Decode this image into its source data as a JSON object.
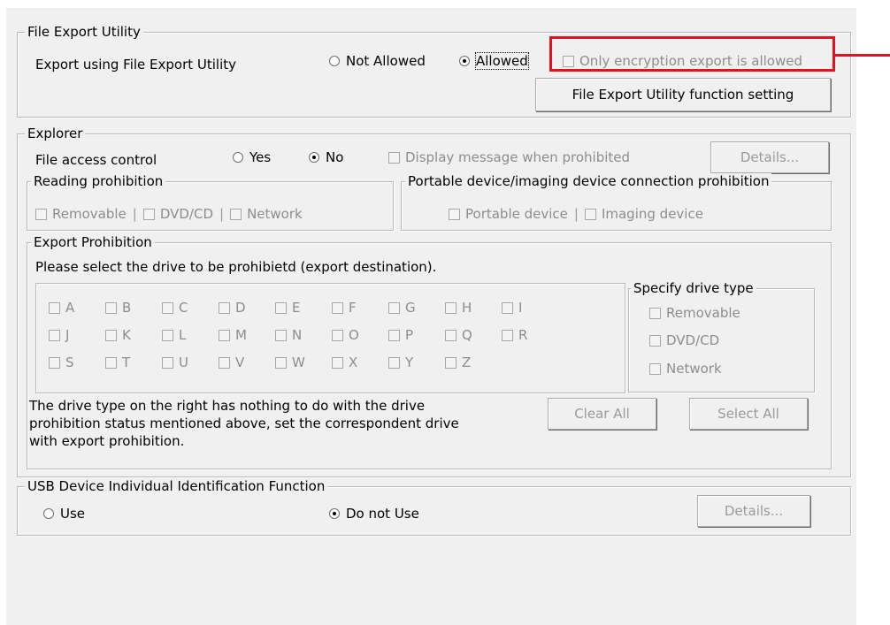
{
  "file_export": {
    "title": "File Export Utility",
    "export_label": "Export using File Export Utility",
    "not_allowed": "Not Allowed",
    "allowed": "Allowed",
    "selected": "allowed",
    "only_encryption": "Only encryption export is allowed",
    "function_setting_button": "File Export Utility function setting",
    "highlight_color": "#e3121c"
  },
  "explorer": {
    "title": "Explorer",
    "file_access_label": "File access control",
    "yes": "Yes",
    "no": "No",
    "selected": "no",
    "display_message": "Display message when prohibited",
    "details_button": "Details...",
    "reading": {
      "title": "Reading prohibition",
      "removable": "Removable",
      "dvd": "DVD/CD",
      "network": "Network"
    },
    "portable": {
      "title": "Portable device/imaging device connection prohibition",
      "portable_device": "Portable device",
      "imaging_device": "Imaging device"
    },
    "export_prohibition": {
      "title": "Export Prohibition",
      "instruction": "Please select the drive to be prohibietd (export destination).",
      "drive_rows": [
        [
          "A",
          "B",
          "C",
          "D",
          "E",
          "F",
          "G",
          "H",
          "I"
        ],
        [
          "J",
          "K",
          "L",
          "M",
          "N",
          "O",
          "P",
          "Q",
          "R"
        ],
        [
          "S",
          "T",
          "U",
          "V",
          "W",
          "X",
          "Y",
          "Z"
        ]
      ],
      "specify": {
        "title": "Specify drive type",
        "removable": "Removable",
        "dvd": "DVD/CD",
        "network": "Network"
      },
      "note_1": "The drive type on the right has nothing to do with the drive",
      "note_2": "prohibition status mentioned above, set the correspondent drive",
      "note_3": "with export prohibition.",
      "clear_all": "Clear All",
      "select_all": "Select All"
    }
  },
  "usb": {
    "title": "USB Device Individual Identification Function",
    "use": "Use",
    "do_not_use": "Do not Use",
    "selected": "do_not_use",
    "details_button": "Details..."
  }
}
